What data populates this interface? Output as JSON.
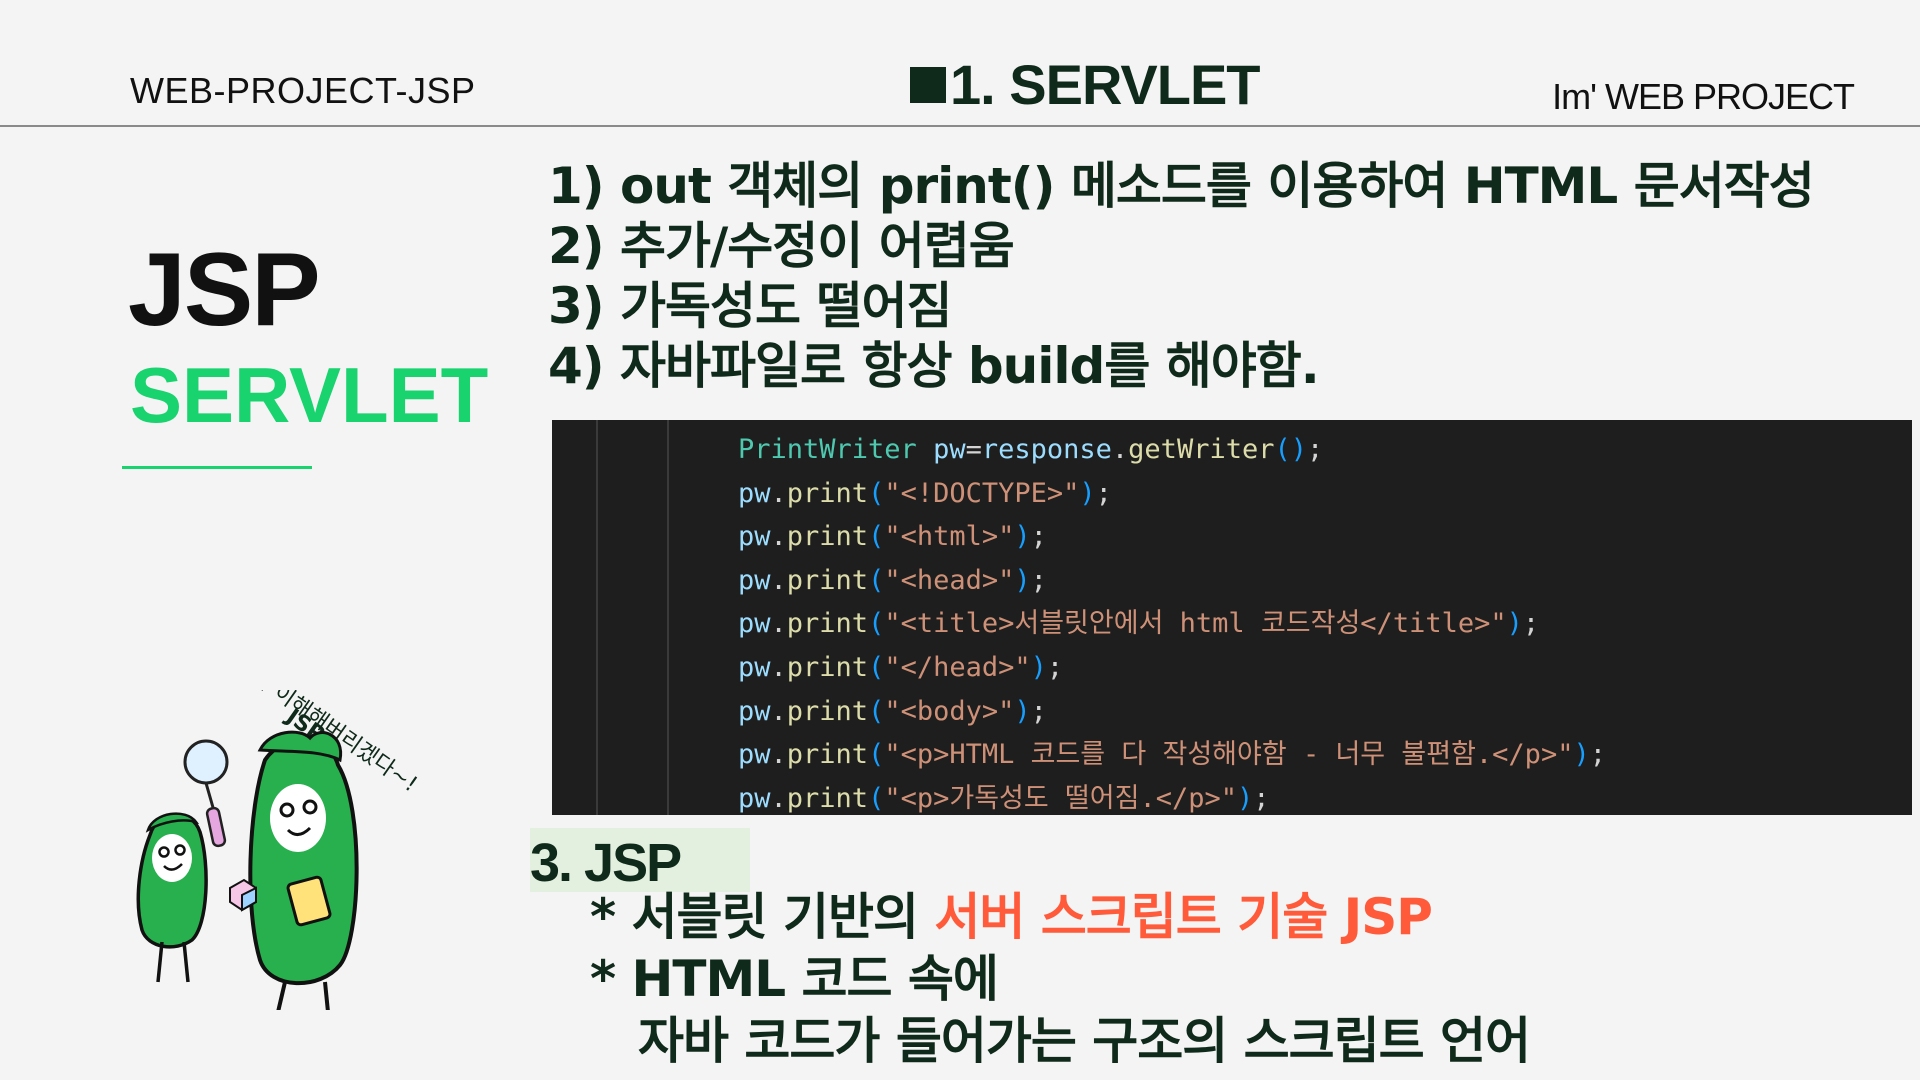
{
  "header": {
    "left": "WEB-PROJECT-JSP",
    "center": "1. SERVLET",
    "right": "Im' WEB PROJECT"
  },
  "sidebar": {
    "title": "JSP",
    "subtitle": "SERVLET"
  },
  "points": [
    "1) out 객체의 print() 메소드를 이용하여 HTML 문서작성",
    "2) 추가/수정이 어렵움",
    "3) 가독성도 떨어짐",
    "4) 자바파일로 항상 build를 해야함."
  ],
  "code": {
    "lines": [
      {
        "obj": "PrintWriter",
        "var": "pw",
        "op": "=",
        "call": "response",
        "method": "getWriter",
        "tail": "();"
      },
      {
        "obj": "pw",
        "method": "print",
        "str": "\"<!DOCTYPE>\""
      },
      {
        "obj": "pw",
        "method": "print",
        "str": "\"<html>\""
      },
      {
        "obj": "pw",
        "method": "print",
        "str": "\"<head>\""
      },
      {
        "obj": "pw",
        "method": "print",
        "str": "\"<title>서블릿안에서 html 코드작성</title>\""
      },
      {
        "obj": "pw",
        "method": "print",
        "str": "\"</head>\""
      },
      {
        "obj": "pw",
        "method": "print",
        "str": "\"<body>\""
      },
      {
        "obj": "pw",
        "method": "print",
        "str": "\"<p>HTML 코드를 다 작성해야함 - 너무 불편함.</p>\""
      },
      {
        "obj": "pw",
        "method": "print",
        "str": "\"<p>가독성도 떨어짐.</p>\""
      }
    ]
  },
  "section3": {
    "label": "3. JSP",
    "bullet1_prefix": "* 서블릿 기반의 ",
    "bullet1_accent": "서버 스크립트 기술 JSP",
    "bullet2_line1": "* HTML 코드 속에",
    "bullet2_line2": "자바 코드가 들어가는 구조의 스크립트 언어"
  },
  "character": {
    "speech_line1": "JSP",
    "speech_line2": "다 이해해버리겠다~!"
  },
  "colors": {
    "accent_green": "#19d36e",
    "accent_red": "#ff5a3a",
    "dark_text": "#0f2a1a",
    "code_bg": "#1e1e1e"
  }
}
